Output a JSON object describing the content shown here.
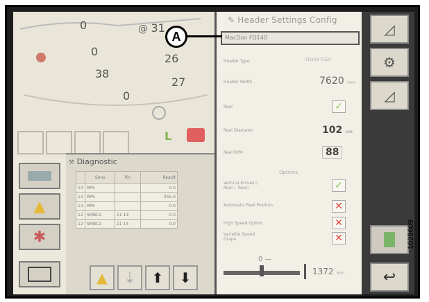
{
  "panel": {
    "title": "Header Settings Config",
    "header_name": "MacDon FD140",
    "rows": [
      {
        "label": "Header Type",
        "value": "FD2XX FLEX"
      },
      {
        "label": "Header Width",
        "value": "7620",
        "unit": "mm"
      },
      {
        "label": "Reel",
        "checked": true
      },
      {
        "label": "Reel Diameter",
        "value": "102",
        "unit": "cm"
      },
      {
        "label": "Reel RPM",
        "value": "88"
      }
    ],
    "options_label": "Options",
    "options": [
      {
        "label": "Vertical Knives (-Reel / -Reel)",
        "checked": true
      },
      {
        "label": "Automatic Reel Position",
        "checked": false
      },
      {
        "label": "High Speed Option",
        "checked": false
      },
      {
        "label": "Variable Speed Drape",
        "checked": false
      }
    ],
    "bottom_top_value": "0",
    "bottom_value": "1372",
    "bottom_unit": "mm"
  },
  "gauges": {
    "values": [
      "0",
      "31",
      "26",
      "0",
      "38",
      "27",
      "0"
    ]
  },
  "diagnostic": {
    "title": "Diagnostic",
    "columns": [
      "Sens",
      "Pin",
      "Result"
    ],
    "rows": [
      {
        "num": "13",
        "sig": "RPS",
        "pin": "",
        "val": "0.0"
      },
      {
        "num": "13",
        "sig": "RPS",
        "pin": "",
        "val": "255.0"
      },
      {
        "num": "13",
        "sig": "RPS",
        "pin": "",
        "val": "0.0"
      },
      {
        "num": "12",
        "sig": "SMBC1",
        "pin": "11 13",
        "val": "0.0"
      },
      {
        "num": "12",
        "sig": "SMBC1",
        "pin": "11 14",
        "val": "0.0"
      }
    ]
  },
  "callout": "A",
  "figure_number": "1029609",
  "colors": {
    "check_green": "#8ec45a",
    "cross_red": "#e04848",
    "panel_bg": "#f2efe6"
  }
}
